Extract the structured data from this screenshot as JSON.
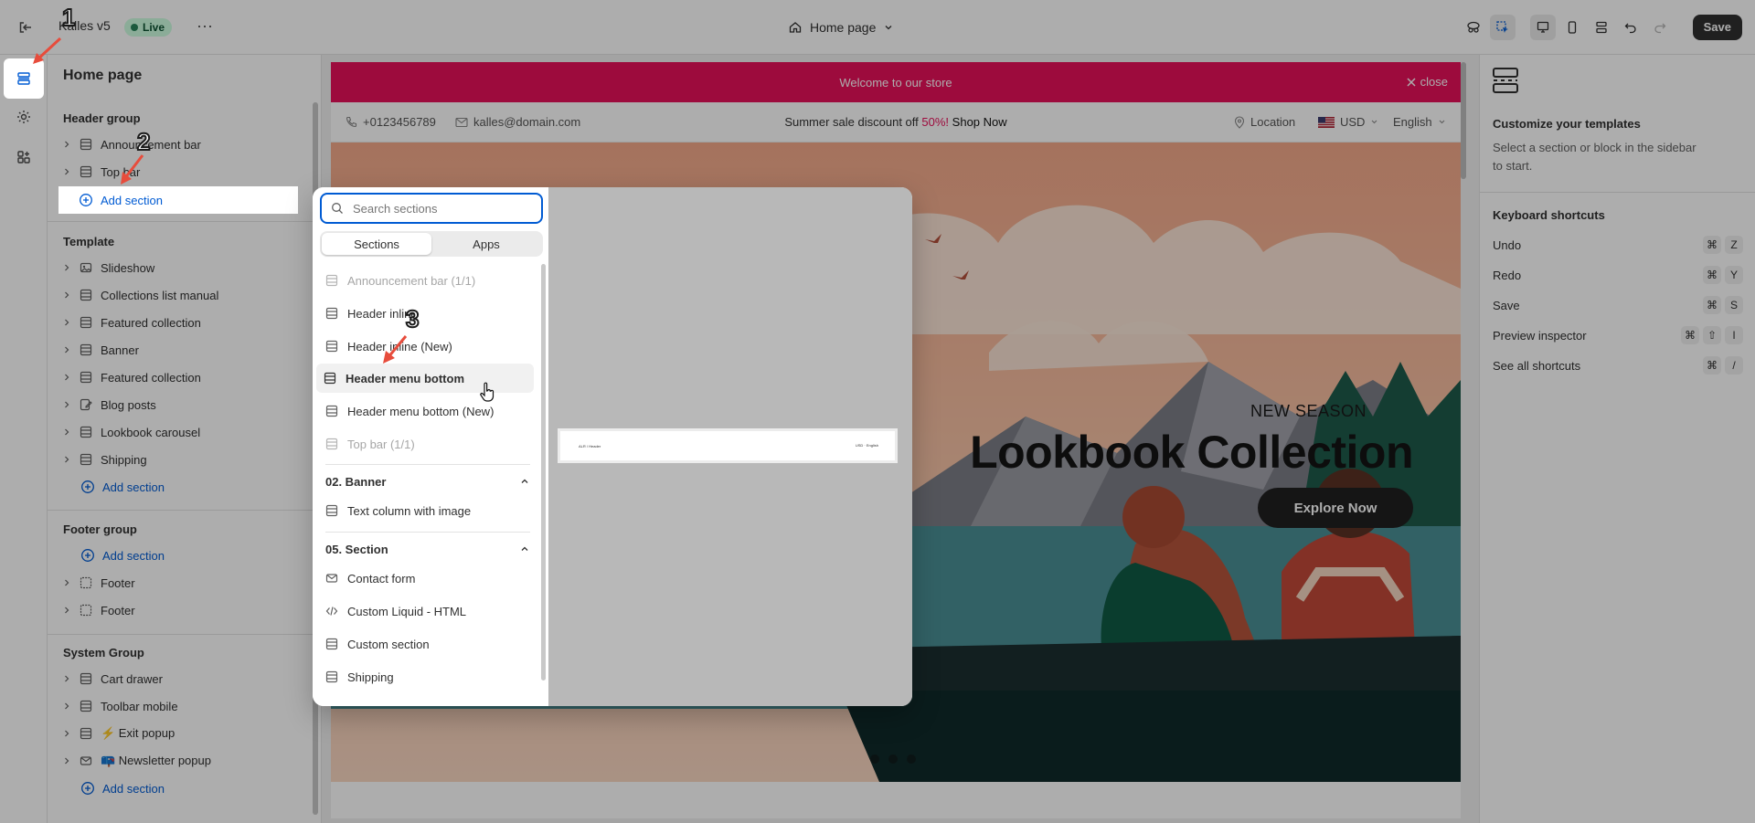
{
  "topbar": {
    "store_name": "Kalles v5",
    "status": "Live",
    "more": "···",
    "page_selector": "Home page",
    "save": "Save"
  },
  "sidebar": {
    "title": "Home page",
    "header_group": {
      "title": "Header group",
      "items": [
        "Announcement bar",
        "Top bar"
      ],
      "add": "Add section"
    },
    "template": {
      "title": "Template",
      "items": [
        "Slideshow",
        "Collections list manual",
        "Featured collection",
        "Banner",
        "Featured collection",
        "Blog posts",
        "Lookbook carousel",
        "Shipping"
      ],
      "add": "Add section"
    },
    "footer_group": {
      "title": "Footer group",
      "add": "Add section",
      "items": [
        "Footer",
        "Footer"
      ]
    },
    "system_group": {
      "title": "System Group",
      "items": [
        "Cart drawer",
        "Toolbar mobile",
        "⚡ Exit popup",
        "📪 Newsletter popup"
      ],
      "add": "Add section"
    }
  },
  "modal": {
    "search_placeholder": "Search sections",
    "tabs": [
      "Sections",
      "Apps"
    ],
    "items": [
      {
        "label": "Announcement bar (1/1)",
        "state": "disabled"
      },
      {
        "label": "Header inline",
        "state": "normal"
      },
      {
        "label": "Header inline (New)",
        "state": "normal"
      },
      {
        "label": "Header menu bottom",
        "state": "hover"
      },
      {
        "label": "Header menu bottom (New)",
        "state": "normal"
      },
      {
        "label": "Top bar (1/1)",
        "state": "disabled"
      }
    ],
    "group_banner": {
      "title": "02. Banner",
      "items": [
        "Text column with image"
      ]
    },
    "group_section": {
      "title": "05. Section",
      "items": [
        "Contact form",
        "Custom Liquid - HTML",
        "Custom section",
        "Shipping"
      ]
    },
    "thumb_left": "ALR / Header",
    "thumb_right": "USD · English"
  },
  "preview": {
    "announcement": "Welcome to our store",
    "close": "close",
    "phone": "+0123456789",
    "email": "kalles@domain.com",
    "promo_text": "Summer sale discount off",
    "promo_highlight": "50%!",
    "promo_link": "Shop Now",
    "location": "Location",
    "currency": "USD",
    "language": "English",
    "hero_kicker": "NEW SEASON",
    "hero_title": "Lookbook Collection",
    "hero_button": "Explore Now"
  },
  "right_panel": {
    "title": "Customize your templates",
    "description": "Select a section or block in the sidebar to start.",
    "shortcuts_title": "Keyboard shortcuts",
    "shortcuts": [
      {
        "label": "Undo",
        "keys": [
          "⌘",
          "Z"
        ]
      },
      {
        "label": "Redo",
        "keys": [
          "⌘",
          "Y"
        ]
      },
      {
        "label": "Save",
        "keys": [
          "⌘",
          "S"
        ]
      },
      {
        "label": "Preview inspector",
        "keys": [
          "⌘",
          "⇧",
          "I"
        ]
      },
      {
        "label": "See all shortcuts",
        "keys": [
          "⌘",
          "/"
        ]
      }
    ]
  },
  "annotations": [
    "1",
    "2",
    "3"
  ],
  "colors": {
    "brand_pink": "#e8115a",
    "accent_blue": "#005bd3",
    "live_green": "#29845a"
  }
}
